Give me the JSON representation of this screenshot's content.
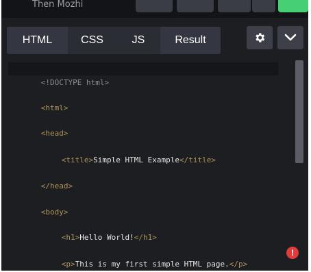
{
  "header": {
    "owner_name": "Then Mozhi"
  },
  "tabs": [
    {
      "label": "HTML"
    },
    {
      "label": "CSS"
    },
    {
      "label": "JS"
    },
    {
      "label": "Result"
    }
  ],
  "icons": {
    "settings": "gear-icon",
    "collapse": "chevron-down-icon",
    "error": "error-icon"
  },
  "error": {
    "glyph": "!"
  },
  "code": {
    "doctype": "<!DOCTYPE html>",
    "html_open": "<html>",
    "head_open": "<head>",
    "title_open": "<title>",
    "title_text": "Simple HTML Example",
    "title_close": "</title>",
    "head_close": "</head>",
    "body_open": "<body>",
    "h1_open": "<h1>",
    "h1_text": "Hello World!",
    "h1_close": "</h1>",
    "p_open": "<p>",
    "p_text": "This is my first simple HTML page.",
    "p_close": "</p>"
  },
  "colors": {
    "editor_bg": "#1d1e22",
    "tab_bg": "#343741",
    "tag_color": "#b0935a",
    "text_color": "#e8e8e8",
    "accent_green": "#47cf73",
    "error_red": "#e03c3c"
  }
}
